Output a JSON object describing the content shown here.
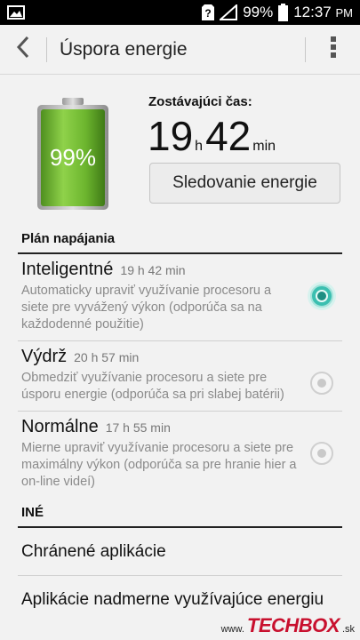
{
  "status_bar": {
    "battery_percent": "99%",
    "time": "12:37",
    "time_suffix": "PM",
    "icons": [
      "image-icon",
      "sim-unknown-icon",
      "signal-icon",
      "battery-icon"
    ]
  },
  "action_bar": {
    "title": "Úspora energie",
    "back_icon": "back-arrow-icon",
    "menu_icon": "overflow-menu-icon"
  },
  "battery": {
    "level_label": "99%",
    "level": 0.99,
    "remaining_label": "Zostávajúci čas:",
    "hours": "19",
    "hours_unit": "h",
    "minutes": "42",
    "minutes_unit": "min",
    "monitor_button": "Sledovanie energie",
    "colors": {
      "fill": "#7cc23a",
      "fill_dark": "#4f8f1f"
    }
  },
  "plans": {
    "header": "Plán napájania",
    "items": [
      {
        "name": "Inteligentné",
        "time": "19 h 42 min",
        "description": "Automaticky upraviť využívanie procesoru a siete pre vyvážený výkon (odporúča sa na každodenné použitie)",
        "selected": true
      },
      {
        "name": "Výdrž",
        "time": "20 h 57 min",
        "description": "Obmedziť využívanie procesoru a siete pre úsporu energie (odporúča sa pri slabej batérii)",
        "selected": false
      },
      {
        "name": "Normálne",
        "time": "17 h 55 min",
        "description": "Mierne upraviť využívanie procesoru a siete pre maximálny výkon (odporúča sa pre hranie hier a on-line videí)",
        "selected": false
      }
    ]
  },
  "other": {
    "header": "INÉ",
    "items": [
      "Chránené aplikácie",
      "Aplikácie nadmerne využívajúce energiu"
    ]
  },
  "watermark": {
    "prefix": "www.",
    "brand": "TECHBOX",
    "suffix": ".sk"
  },
  "accent_color": "#3bbfb0"
}
